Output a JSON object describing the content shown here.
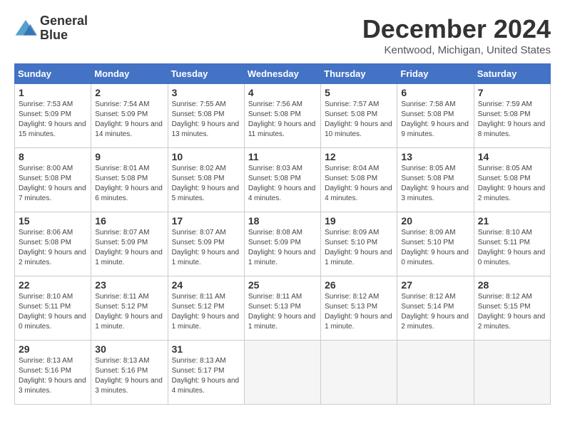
{
  "logo": {
    "line1": "General",
    "line2": "Blue"
  },
  "title": "December 2024",
  "subtitle": "Kentwood, Michigan, United States",
  "days_of_week": [
    "Sunday",
    "Monday",
    "Tuesday",
    "Wednesday",
    "Thursday",
    "Friday",
    "Saturday"
  ],
  "weeks": [
    [
      {
        "day": "1",
        "sunrise": "7:53 AM",
        "sunset": "5:09 PM",
        "daylight": "9 hours and 15 minutes."
      },
      {
        "day": "2",
        "sunrise": "7:54 AM",
        "sunset": "5:09 PM",
        "daylight": "9 hours and 14 minutes."
      },
      {
        "day": "3",
        "sunrise": "7:55 AM",
        "sunset": "5:08 PM",
        "daylight": "9 hours and 13 minutes."
      },
      {
        "day": "4",
        "sunrise": "7:56 AM",
        "sunset": "5:08 PM",
        "daylight": "9 hours and 11 minutes."
      },
      {
        "day": "5",
        "sunrise": "7:57 AM",
        "sunset": "5:08 PM",
        "daylight": "9 hours and 10 minutes."
      },
      {
        "day": "6",
        "sunrise": "7:58 AM",
        "sunset": "5:08 PM",
        "daylight": "9 hours and 9 minutes."
      },
      {
        "day": "7",
        "sunrise": "7:59 AM",
        "sunset": "5:08 PM",
        "daylight": "9 hours and 8 minutes."
      }
    ],
    [
      {
        "day": "8",
        "sunrise": "8:00 AM",
        "sunset": "5:08 PM",
        "daylight": "9 hours and 7 minutes."
      },
      {
        "day": "9",
        "sunrise": "8:01 AM",
        "sunset": "5:08 PM",
        "daylight": "9 hours and 6 minutes."
      },
      {
        "day": "10",
        "sunrise": "8:02 AM",
        "sunset": "5:08 PM",
        "daylight": "9 hours and 5 minutes."
      },
      {
        "day": "11",
        "sunrise": "8:03 AM",
        "sunset": "5:08 PM",
        "daylight": "9 hours and 4 minutes."
      },
      {
        "day": "12",
        "sunrise": "8:04 AM",
        "sunset": "5:08 PM",
        "daylight": "9 hours and 4 minutes."
      },
      {
        "day": "13",
        "sunrise": "8:05 AM",
        "sunset": "5:08 PM",
        "daylight": "9 hours and 3 minutes."
      },
      {
        "day": "14",
        "sunrise": "8:05 AM",
        "sunset": "5:08 PM",
        "daylight": "9 hours and 2 minutes."
      }
    ],
    [
      {
        "day": "15",
        "sunrise": "8:06 AM",
        "sunset": "5:08 PM",
        "daylight": "9 hours and 2 minutes."
      },
      {
        "day": "16",
        "sunrise": "8:07 AM",
        "sunset": "5:09 PM",
        "daylight": "9 hours and 1 minute."
      },
      {
        "day": "17",
        "sunrise": "8:07 AM",
        "sunset": "5:09 PM",
        "daylight": "9 hours and 1 minute."
      },
      {
        "day": "18",
        "sunrise": "8:08 AM",
        "sunset": "5:09 PM",
        "daylight": "9 hours and 1 minute."
      },
      {
        "day": "19",
        "sunrise": "8:09 AM",
        "sunset": "5:10 PM",
        "daylight": "9 hours and 1 minute."
      },
      {
        "day": "20",
        "sunrise": "8:09 AM",
        "sunset": "5:10 PM",
        "daylight": "9 hours and 0 minutes."
      },
      {
        "day": "21",
        "sunrise": "8:10 AM",
        "sunset": "5:11 PM",
        "daylight": "9 hours and 0 minutes."
      }
    ],
    [
      {
        "day": "22",
        "sunrise": "8:10 AM",
        "sunset": "5:11 PM",
        "daylight": "9 hours and 0 minutes."
      },
      {
        "day": "23",
        "sunrise": "8:11 AM",
        "sunset": "5:12 PM",
        "daylight": "9 hours and 1 minute."
      },
      {
        "day": "24",
        "sunrise": "8:11 AM",
        "sunset": "5:12 PM",
        "daylight": "9 hours and 1 minute."
      },
      {
        "day": "25",
        "sunrise": "8:11 AM",
        "sunset": "5:13 PM",
        "daylight": "9 hours and 1 minute."
      },
      {
        "day": "26",
        "sunrise": "8:12 AM",
        "sunset": "5:13 PM",
        "daylight": "9 hours and 1 minute."
      },
      {
        "day": "27",
        "sunrise": "8:12 AM",
        "sunset": "5:14 PM",
        "daylight": "9 hours and 2 minutes."
      },
      {
        "day": "28",
        "sunrise": "8:12 AM",
        "sunset": "5:15 PM",
        "daylight": "9 hours and 2 minutes."
      }
    ],
    [
      {
        "day": "29",
        "sunrise": "8:13 AM",
        "sunset": "5:16 PM",
        "daylight": "9 hours and 3 minutes."
      },
      {
        "day": "30",
        "sunrise": "8:13 AM",
        "sunset": "5:16 PM",
        "daylight": "9 hours and 3 minutes."
      },
      {
        "day": "31",
        "sunrise": "8:13 AM",
        "sunset": "5:17 PM",
        "daylight": "9 hours and 4 minutes."
      },
      null,
      null,
      null,
      null
    ]
  ]
}
